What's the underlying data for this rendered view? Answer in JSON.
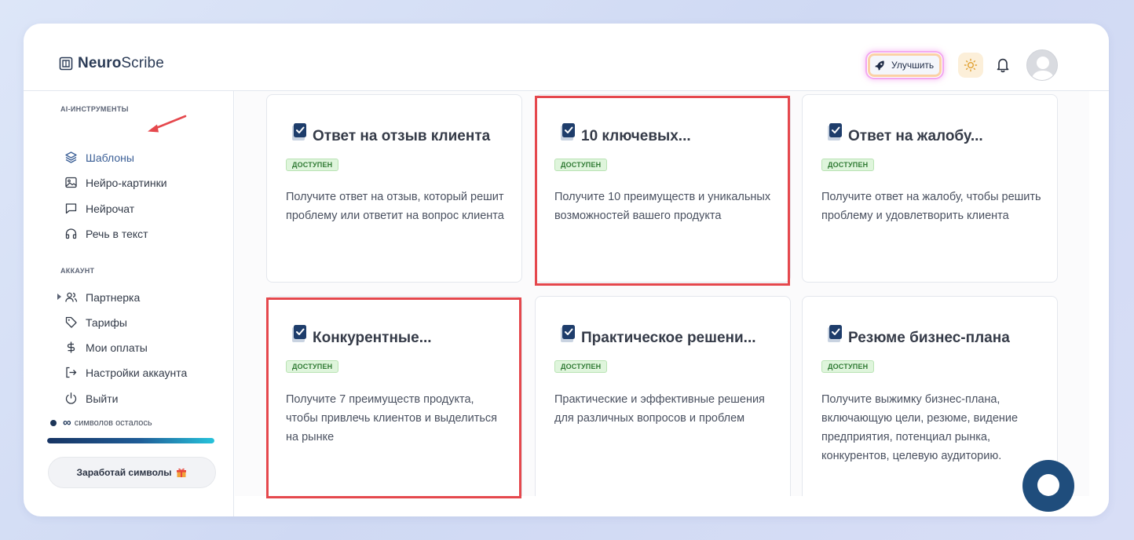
{
  "app": {
    "logo_bold": "Neuro",
    "logo_light": "Scribe"
  },
  "header": {
    "upgrade_label": "Улучшить"
  },
  "sidebar": {
    "section_tools": "AI-ИНСТРУМЕНТЫ",
    "tools": [
      {
        "label": "Шаблоны",
        "icon": "layers-icon",
        "active": true
      },
      {
        "label": "Нейро-картинки",
        "icon": "image-icon"
      },
      {
        "label": "Нейрочат",
        "icon": "chat-icon"
      },
      {
        "label": "Речь в текст",
        "icon": "headphones-icon"
      }
    ],
    "section_account": "АККАУНТ",
    "account": [
      {
        "label": "Партнерка",
        "icon": "users-icon"
      },
      {
        "label": "Тарифы",
        "icon": "tag-icon"
      },
      {
        "label": "Мои оплаты",
        "icon": "dollar-icon"
      },
      {
        "label": "Настройки аккаунта",
        "icon": "logout-arrow-icon"
      },
      {
        "label": "Выйти",
        "icon": "power-icon"
      }
    ],
    "symbols_value": "∞",
    "symbols_label": "символов осталось",
    "symbols_progress": 1.0,
    "earn_label": "Заработай символы",
    "earn_emoji": "🎁"
  },
  "cards": [
    {
      "title": "Ответ на отзыв клиента",
      "badge": "ДОСТУПЕН",
      "desc": "Получите ответ на отзыв, который решит проблему или ответит на вопрос клиента",
      "highlighted": false
    },
    {
      "title": "10 ключевых...",
      "badge": "ДОСТУПЕН",
      "desc": "Получите 10 преимуществ и уникальных возможностей вашего продукта",
      "highlighted": true
    },
    {
      "title": "Ответ на жалобу...",
      "badge": "ДОСТУПЕН",
      "desc": "Получите ответ на жалобу, чтобы решить проблему и удовлетворить клиента",
      "highlighted": false
    },
    {
      "title": "Конкурентные...",
      "badge": "ДОСТУПЕН",
      "desc": "Получите 7 преимуществ продукта, чтобы привлечь клиентов и выделиться на рынке",
      "highlighted": true
    },
    {
      "title": "Практическое решени...",
      "badge": "ДОСТУПЕН",
      "desc": "Практические и эффективные решения для различных вопросов и проблем",
      "highlighted": false
    },
    {
      "title": "Резюме бизнес-плана",
      "badge": "ДОСТУПЕН",
      "desc": "Получите выжимку бизнес-плана, включающую цели, резюме, видение предприятия, потенциал рынка, конкурентов, целевую аудиторию.",
      "highlighted": false
    }
  ],
  "colors": {
    "accent": "#3b5f96",
    "badge_bg": "#dff5dc",
    "badge_text": "#2f7a33",
    "highlight": "#e5484d",
    "fab": "#1f4d7c"
  }
}
